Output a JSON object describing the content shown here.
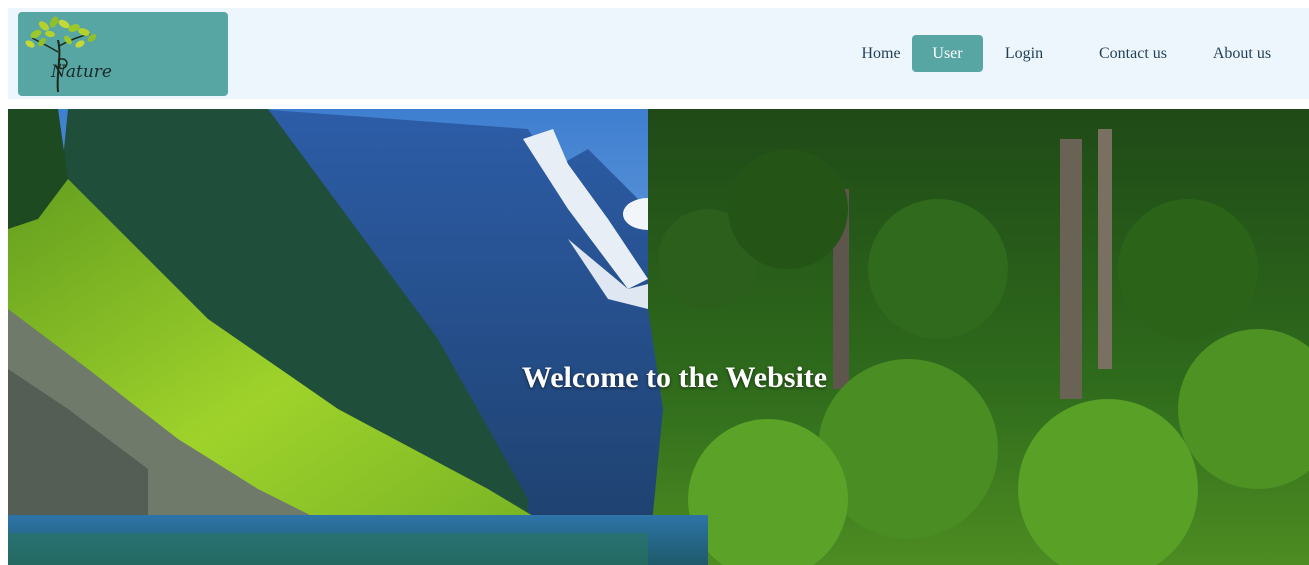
{
  "logo": {
    "text": "Nature",
    "icon": "tree-logo-icon"
  },
  "nav": {
    "items": [
      {
        "label": "Home",
        "active": false
      },
      {
        "label": "User",
        "active": true
      },
      {
        "label": "Login",
        "active": false
      },
      {
        "label": "Contact us",
        "active": false
      },
      {
        "label": "About us",
        "active": false
      }
    ]
  },
  "hero": {
    "title": "Welcome to the Website"
  },
  "colors": {
    "accent": "#58a6a4",
    "header_bg": "#eef6fd",
    "nav_text": "#1f3f57"
  }
}
